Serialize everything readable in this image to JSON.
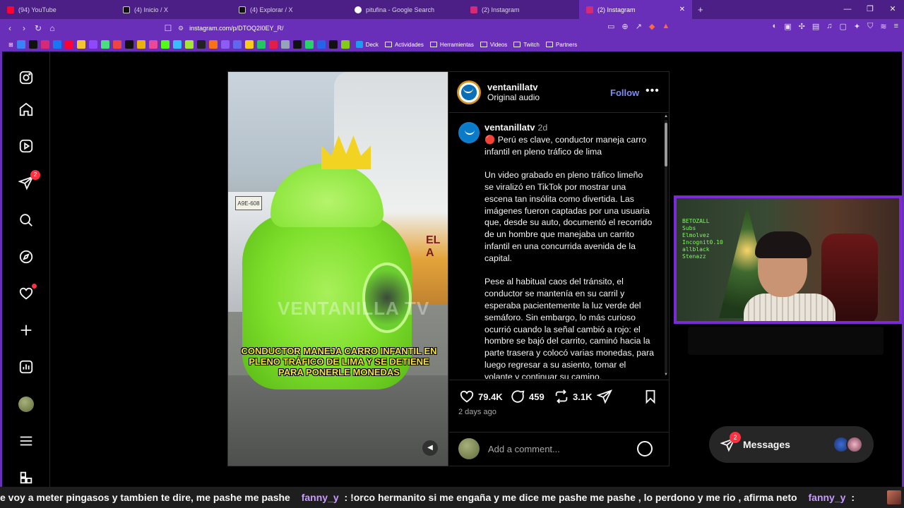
{
  "browser": {
    "tabs": [
      {
        "title": "(94) YouTube",
        "color": "#ff0033",
        "active": false
      },
      {
        "title": "(4) Inicio / X",
        "color": "#000000",
        "active": false
      },
      {
        "title": "(4) Explorar / X",
        "color": "#000000",
        "active": false
      },
      {
        "title": "pitufina - Google Search",
        "color": "#ffffff",
        "active": false
      },
      {
        "title": "(2) Instagram",
        "color": "#d62976",
        "active": false
      },
      {
        "title": "(2) Instagram",
        "color": "#d62976",
        "active": true
      }
    ],
    "new_tab": "+",
    "url": "instagram.com/p/DTOQ2I0EY_R/",
    "bookmarks": [
      "Deck",
      "Actividades",
      "Herramientas",
      "Videos",
      "Twitch",
      "Partners"
    ]
  },
  "rail": {
    "notifications_badge": "2"
  },
  "post": {
    "username": "ventanillatv",
    "audio": "Original audio",
    "follow": "Follow",
    "more": "•••",
    "video_caption": "CONDUCTOR MANEJA CARRO INFANTIL EN PLENO TRÁFICO DE LIMA Y SE DETIENE PARA PONERLE MONEDAS",
    "watermark": "VENTANILLA TV",
    "bus_text": "EL A",
    "plate": "A9E-608",
    "caption_user": "ventanillatv",
    "caption_time": "2d",
    "caption_p1": "🔴 Perú es clave, conductor maneja carro infantil en pleno tráfico de lima",
    "caption_p2": "Un video grabado en pleno tráfico limeño se viralizó en TikTok por mostrar una escena tan insólita como divertida. Las imágenes fueron captadas por una usuaria que, desde su auto, documentó el recorrido de un hombre que manejaba un carrito infantil en una concurrida avenida de la capital.",
    "caption_p3": "Pese al habitual caos del tránsito, el conductor se mantenía en su carril y esperaba pacientemente la luz verde del semáforo. Sin embargo, lo más curioso ocurrió cuando la señal cambió a rojo: el hombre se bajó del carrito, caminó hacia la parte trasera y colocó varias monedas, para luego regresar a su asiento, tomar el volante y continuar su camino.",
    "likes": "79.4K",
    "comments": "459",
    "reposts": "3.1K",
    "posted": "2 days ago",
    "comment_placeholder": "Add a comment..."
  },
  "webcam": {
    "chalkboard": "BETOZALL\nSubs\nElmolvez\nIncognit0.10\nallblack\nStenazz"
  },
  "messages": {
    "label": "Messages",
    "badge": "2"
  },
  "ticker": {
    "msg1": "e voy a meter pingasos y tambien te dire, me pashe me pashe",
    "user1": "fanny_y",
    "msg2": ": !orco hermanito si me engaña y me dice me pashe me pashe , lo perdono y me rio , afirma neto",
    "user2": "fanny_y",
    "msg3": ":"
  }
}
